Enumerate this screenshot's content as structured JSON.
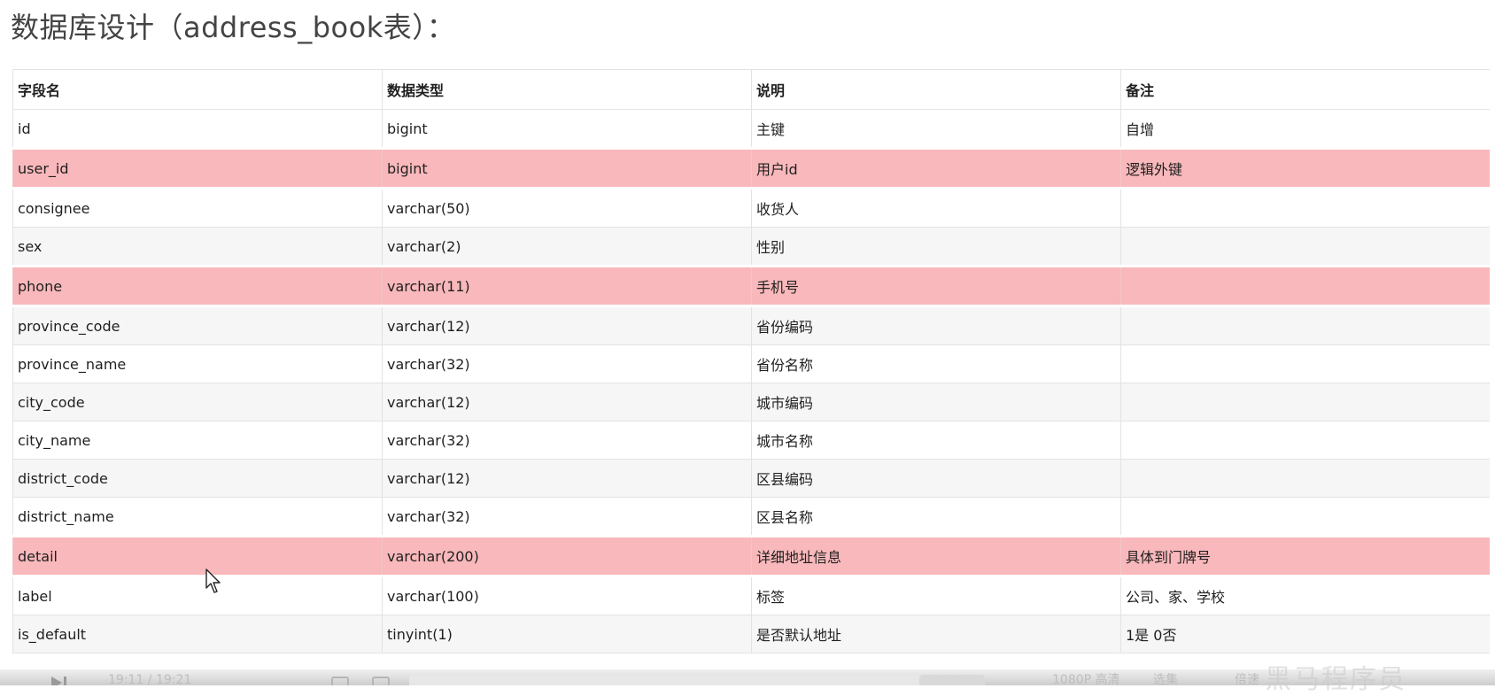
{
  "title": "数据库设计（address_book表）：",
  "table": {
    "headers": [
      "字段名",
      "数据类型",
      "说明",
      "备注"
    ],
    "rows": [
      {
        "field": "id",
        "type": "bigint",
        "desc": "主键",
        "note": "自增",
        "style": "normal"
      },
      {
        "field": "user_id",
        "type": "bigint",
        "desc": "用户id",
        "note": "逻辑外键",
        "style": "highlight"
      },
      {
        "field": "consignee",
        "type": "varchar(50)",
        "desc": "收货人",
        "note": "",
        "style": "normal"
      },
      {
        "field": "sex",
        "type": "varchar(2)",
        "desc": "性别",
        "note": "",
        "style": "alt"
      },
      {
        "field": "phone",
        "type": "varchar(11)",
        "desc": "手机号",
        "note": "",
        "style": "highlight"
      },
      {
        "field": "province_code",
        "type": "varchar(12)",
        "desc": "省份编码",
        "note": "",
        "style": "alt"
      },
      {
        "field": "province_name",
        "type": "varchar(32)",
        "desc": "省份名称",
        "note": "",
        "style": "normal"
      },
      {
        "field": "city_code",
        "type": "varchar(12)",
        "desc": "城市编码",
        "note": "",
        "style": "alt"
      },
      {
        "field": "city_name",
        "type": "varchar(32)",
        "desc": "城市名称",
        "note": "",
        "style": "normal"
      },
      {
        "field": "district_code",
        "type": "varchar(12)",
        "desc": "区县编码",
        "note": "",
        "style": "alt"
      },
      {
        "field": "district_name",
        "type": "varchar(32)",
        "desc": "区县名称",
        "note": "",
        "style": "normal"
      },
      {
        "field": "detail",
        "type": "varchar(200)",
        "desc": "详细地址信息",
        "note": "具体到门牌号",
        "style": "highlight"
      },
      {
        "field": "label",
        "type": "varchar(100)",
        "desc": "标签",
        "note": "公司、家、学校",
        "style": "normal"
      },
      {
        "field": "is_default",
        "type": "tinyint(1)",
        "desc": "是否默认地址",
        "note": "1是 0否",
        "style": "alt"
      }
    ]
  },
  "colors": {
    "highlight": "#f9b8bb",
    "alt_row": "#f6f6f6",
    "title": "#444444"
  },
  "player_bar": {
    "time": "19:11 / 19:21",
    "quality": "1080P 高清",
    "select": "选集",
    "speed": "倍速"
  },
  "watermark": "黑马程序员"
}
